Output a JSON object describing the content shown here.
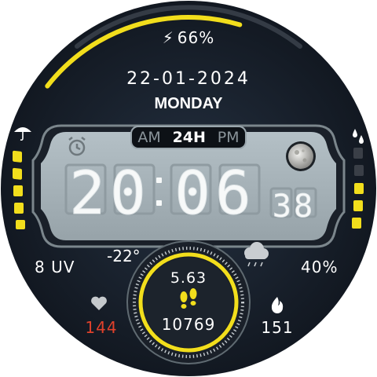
{
  "battery": {
    "icon": "lightning-bolt-icon",
    "value": "66%",
    "level": 0.66
  },
  "date": "22-01-2024",
  "weekday": "MONDAY",
  "time_format": {
    "options": [
      "AM",
      "24H",
      "PM"
    ],
    "active": "24H"
  },
  "time": {
    "hours": "20",
    "minutes": "06",
    "seconds": "38"
  },
  "uv": "8 UV",
  "temperature": "-22°",
  "humidity": "40%",
  "distance": "5.63",
  "steps": "10769",
  "heart_rate": "144",
  "calories": "151",
  "icons": {
    "alarm": "alarm-clock-icon",
    "moon": "moon-phase-icon",
    "weather": "cloud-rain-icon",
    "umbrella": "umbrella-icon",
    "rain_drops": "rain-drops-icon",
    "heart": "heart-icon",
    "flame": "flame-icon",
    "footsteps": "footsteps-icon"
  },
  "colors": {
    "accent": "#f2de1c",
    "background": "#171d26",
    "lcd": "#a4b0b6",
    "heart_rate": "#e0412b"
  }
}
